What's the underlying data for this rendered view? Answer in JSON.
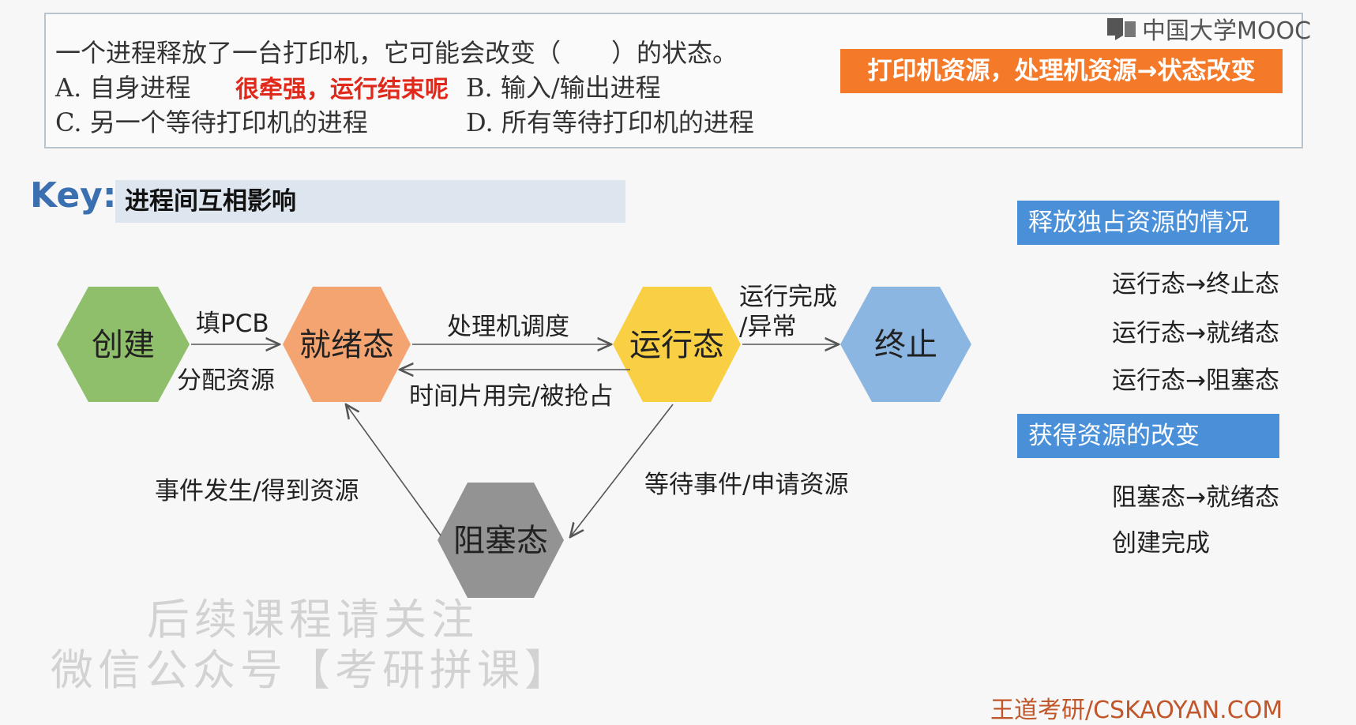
{
  "question": {
    "line1": "一个进程释放了一台打印机，它可能会改变（　　）的状态。",
    "option_a": "A. 自身进程",
    "option_a_comment": "很牵强，运行结束呢",
    "option_b": "B. 输入/输出进程",
    "option_c": "C. 另一个等待打印机的进程",
    "option_d": "D. 所有等待打印机的进程",
    "note": "打印机资源，处理机资源→状态改变"
  },
  "logo": {
    "text": "中国大学MOOC",
    "icon": "mooc-logo-icon"
  },
  "key": {
    "label": "Key:",
    "title": "进程间互相影响"
  },
  "diagram": {
    "nodes": {
      "create": "创建",
      "ready": "就绪态",
      "running": "运行态",
      "terminate": "终止",
      "blocked": "阻塞态"
    },
    "colors": {
      "create": "#8fbf6a",
      "ready": "#f4a471",
      "running": "#f9cf44",
      "terminate": "#8cb6e2",
      "blocked": "#939393"
    },
    "edges": {
      "create_ready_top": "填PCB",
      "create_ready_bottom": "分配资源",
      "ready_running": "处理机调度",
      "running_ready": "时间片用完/被抢占",
      "running_terminate_1": "运行完成",
      "running_terminate_2": "/异常",
      "running_blocked": "等待事件/申请资源",
      "blocked_ready": "事件发生/得到资源"
    }
  },
  "side": {
    "release_header": "释放独占资源的情况",
    "release_items": [
      "运行态→终止态",
      "运行态→就绪态",
      "运行态→阻塞态"
    ],
    "acquire_header": "获得资源的改变",
    "acquire_items": [
      "阻塞态→就绪态",
      "创建完成"
    ]
  },
  "watermark": {
    "line1": "后续课程请关注",
    "line2": "微信公众号【考研拼课】"
  },
  "footer": "王道考研/CSKAOYAN.COM"
}
